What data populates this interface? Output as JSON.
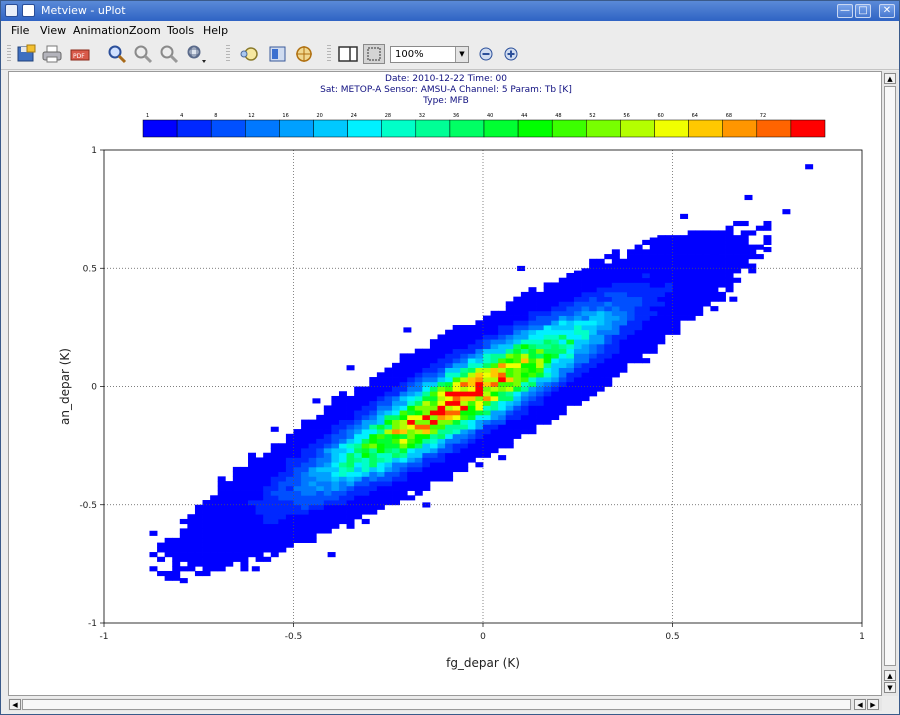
{
  "window": {
    "title": "Metview - uPlot",
    "controls": [
      "minimize-icon",
      "maximize-icon",
      "close-icon"
    ]
  },
  "menu": [
    "File",
    "View",
    "Animation",
    "Zoom",
    "Tools",
    "Help"
  ],
  "toolbar": {
    "icons": [
      "save-icon",
      "print-icon",
      "export-icon",
      "zoom-icon",
      "zoom-out-icon",
      "zoom-reset-icon",
      "zoom-menu-icon",
      "magnifier-icon",
      "layer-icon",
      "crosshair-icon",
      "sidebar-toggle-icon",
      "frame-select-icon"
    ],
    "zoom_value": "100%",
    "zoom_out_icon": "minus-circle-icon",
    "zoom_in_icon": "plus-circle-icon"
  },
  "plot_header": {
    "line1": "Date: 2010-12-22 Time: 00",
    "line2": "Sat: METOP-A Sensor: AMSU-A Channel: 5 Param: Tb [K]",
    "line3": "Type: MFB"
  },
  "chart_data": {
    "type": "heatmap",
    "title": "",
    "xlabel": "fg_depar (K)",
    "ylabel": "an_depar (K)",
    "xlim": [
      -1,
      1
    ],
    "ylim": [
      -1,
      1
    ],
    "x_ticks": [
      "-1",
      "-0.5",
      "0",
      "0.5",
      "1"
    ],
    "y_ticks": [
      "-1",
      "-0.5",
      "0",
      "0.5",
      "1"
    ],
    "grid": true,
    "bin_width": 0.02,
    "colorbar": {
      "labels": [
        "1",
        "4",
        "8",
        "12",
        "16",
        "20",
        "24",
        "28",
        "32",
        "36",
        "40",
        "44",
        "48",
        "52",
        "56",
        "60",
        "64",
        "68",
        "72"
      ],
      "colors": [
        "#0000ff",
        "#0028ff",
        "#0050ff",
        "#0078ff",
        "#00a0ff",
        "#00c8ff",
        "#00f0ff",
        "#00ffc8",
        "#00ff96",
        "#00ff64",
        "#00ff32",
        "#00ff00",
        "#3cff00",
        "#78ff00",
        "#b4ff00",
        "#f0ff00",
        "#ffc800",
        "#ff9600",
        "#ff6400",
        "#ff0000"
      ]
    },
    "density": {
      "relation": "an_depar ≈ 0.93 × fg_depar",
      "peak_count": 72,
      "peak_at": {
        "fg_depar": -0.08,
        "an_depar": -0.07
      },
      "outliers": [
        {
          "x": -0.87,
          "y": -0.62
        },
        {
          "x": -0.79,
          "y": -0.82
        },
        {
          "x": -0.7,
          "y": -0.76
        },
        {
          "x": -0.73,
          "y": -0.5
        },
        {
          "x": -0.6,
          "y": -0.77
        },
        {
          "x": -0.54,
          "y": -0.69
        },
        {
          "x": -0.55,
          "y": -0.18
        },
        {
          "x": -0.44,
          "y": -0.06
        },
        {
          "x": -0.35,
          "y": 0.08
        },
        {
          "x": -0.2,
          "y": 0.24
        },
        {
          "x": 0.1,
          "y": 0.5
        },
        {
          "x": 0.45,
          "y": 0.62
        },
        {
          "x": 0.61,
          "y": 0.55
        },
        {
          "x": 0.7,
          "y": 0.8
        },
        {
          "x": 0.8,
          "y": 0.74
        },
        {
          "x": 0.86,
          "y": 0.93
        },
        {
          "x": 0.75,
          "y": 0.58
        },
        {
          "x": 0.66,
          "y": 0.37
        },
        {
          "x": 0.3,
          "y": 0.05
        },
        {
          "x": 0.05,
          "y": -0.3
        },
        {
          "x": -0.15,
          "y": -0.5
        },
        {
          "x": -0.4,
          "y": -0.71
        },
        {
          "x": 0.25,
          "y": 0.48
        },
        {
          "x": 0.53,
          "y": 0.72
        }
      ]
    }
  }
}
